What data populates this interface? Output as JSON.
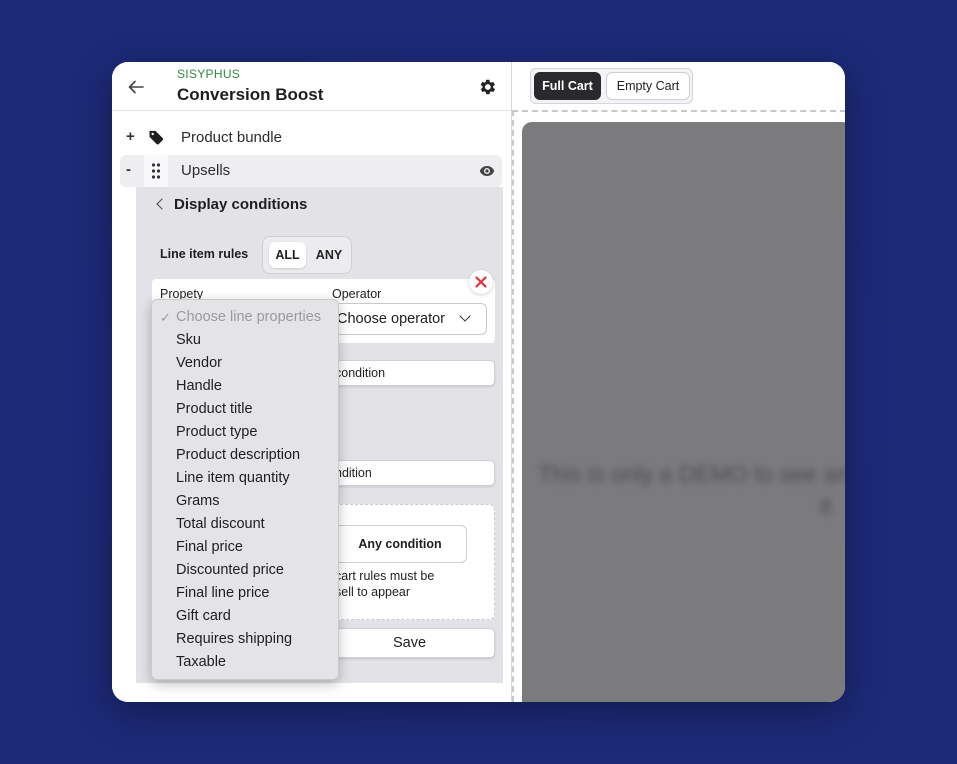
{
  "header": {
    "brand": "SISYPHUS",
    "title": "Conversion Boost"
  },
  "sections": [
    {
      "sign": "+",
      "label": "Product bundle",
      "icon": "tag-icon"
    },
    {
      "sign": "-",
      "label": "Upsells",
      "icon": "drag-handle-icon"
    }
  ],
  "conditions": {
    "back_label": "Display conditions",
    "line_item_rules_label": "Line item rules",
    "toggle": {
      "all": "ALL",
      "any": "ANY",
      "selected": "ALL"
    },
    "rule": {
      "property_label": "Propety",
      "operator_label": "Operator",
      "operator_value": "Choose operator"
    },
    "add_condition_1": "condition",
    "add_condition_2": "ndition",
    "any_condition": "Any condition",
    "cart_note": "cart rules must be\nsell to appear",
    "save": "Save"
  },
  "property_dropdown": {
    "options": [
      "Choose line properties",
      "Sku",
      "Vendor",
      "Handle",
      "Product title",
      "Product type",
      "Product description",
      "Line item quantity",
      "Grams",
      "Total discount",
      "Final price",
      "Discounted price",
      "Final line price",
      "Gift card",
      "Requires shipping",
      "Taxable"
    ],
    "selected": "Choose line properties"
  },
  "preview": {
    "tabs": {
      "full": "Full Cart",
      "empty": "Empty Cart"
    },
    "active_tab": "Full Cart",
    "blurred_text_line1": "This is only a DEMO to see an",
    "blurred_text_line2": "it"
  },
  "colors": {
    "brand_green": "#2e8b3e",
    "close_red": "#e0333a",
    "active_tab": "#2a2a2c"
  }
}
